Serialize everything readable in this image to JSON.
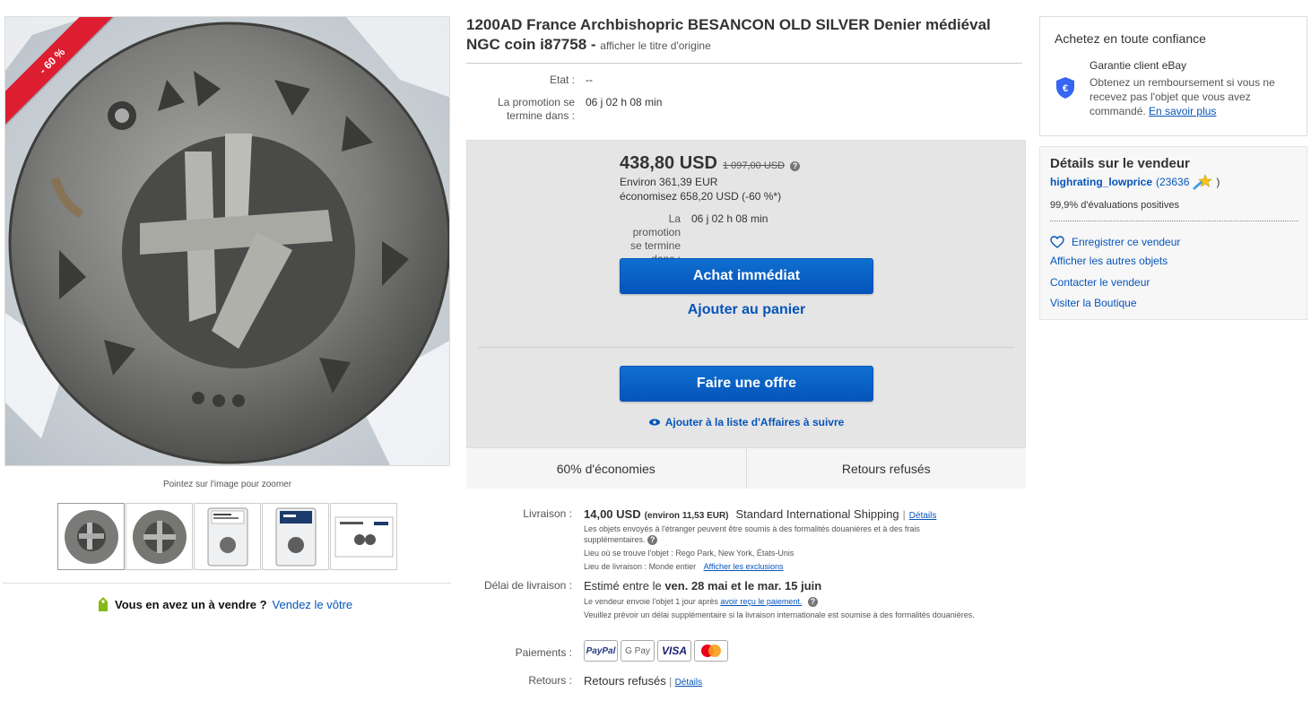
{
  "badge": {
    "discount": "- 60 %"
  },
  "gallery": {
    "zoom_hint": "Pointez sur l'image pour zoomer",
    "thumbnails": [
      "coin-obverse",
      "coin-reverse",
      "slab-front",
      "slab-back",
      "certificate"
    ]
  },
  "sell": {
    "question": "Vous en avez un à vendre ?",
    "link": "Vendez le vôtre"
  },
  "title": {
    "text": "1200AD France Archbishopric BESANCON OLD SILVER Denier médiéval NGC coin i87758 -",
    "original_link": "afficher le titre d'origine"
  },
  "condition": {
    "label": "Etat :",
    "value": "--"
  },
  "promo": {
    "label": "La promotion se termine dans :",
    "value": "06 j 02 h 08 min"
  },
  "buybox": {
    "price": "438,80 USD",
    "was_price": "1 097,00 USD",
    "help": "?",
    "approx": "Environ 361,39 EUR",
    "savings": "économisez 658,20 USD (-60 %*)",
    "promo_label": "La promotion se termine dans :",
    "promo_value": "06 j 02 h 08 min",
    "buy_now": "Achat immédiat",
    "add_cart": "Ajouter au panier",
    "make_offer": "Faire une offre",
    "watch": "Ajouter à la liste d'Affaires à suivre",
    "footer_left": "60% d'économies",
    "footer_right": "Retours refusés"
  },
  "shipping": {
    "label": "Livraison :",
    "price": "14,00 USD",
    "approx": "(environ 11,53 EUR)",
    "method": "Standard International Shipping",
    "details": "Détails",
    "note": "Les objets envoyés à l'étranger peuvent être soumis à des formalités douanières et à des frais supplémentaires.",
    "location_label": "Lieu où se trouve l'objet :",
    "location": "Rego Park, New York, États-Unis",
    "ships_to_label": "Lieu de livraison :",
    "ships_to": "Monde entier",
    "exclusions": "Afficher les exclusions"
  },
  "delivery": {
    "label": "Délai de livraison :",
    "estimate_prefix": "Estimé entre le",
    "estimate": "ven. 28 mai et le mar. 15 juin",
    "handling": "Le vendeur envoie l'objet 1 jour après",
    "handling_link": "avoir reçu le paiement.",
    "note": "Veuillez prévoir un délai supplémentaire si la livraison internationale est soumise à des formalités douanières."
  },
  "payments": {
    "label": "Paiements :",
    "methods": [
      "PayPal",
      "G Pay",
      "VISA",
      "mastercard"
    ]
  },
  "returns": {
    "label": "Retours :",
    "value": "Retours refusés",
    "details": "Détails"
  },
  "trust": {
    "title": "Achetez en toute confiance",
    "head": "Garantie client eBay",
    "body": "Obtenez un remboursement si vous ne recevez pas l'objet que vous avez commandé.",
    "link": "En savoir plus"
  },
  "seller": {
    "title": "Détails sur le vendeur",
    "name": "highrating_lowprice",
    "score": "(23636",
    "score_close": ")",
    "positive": "99,9% d'évaluations positives",
    "follow": "Enregistrer ce vendeur",
    "other_items": "Afficher les autres objets",
    "contact": "Contacter le vendeur",
    "store": "Visiter la Boutique"
  },
  "colors": {
    "link": "#0654ba",
    "button": "#0654ba",
    "ribbon": "#dd1e31",
    "buybox_bg": "#e5e5e5"
  }
}
